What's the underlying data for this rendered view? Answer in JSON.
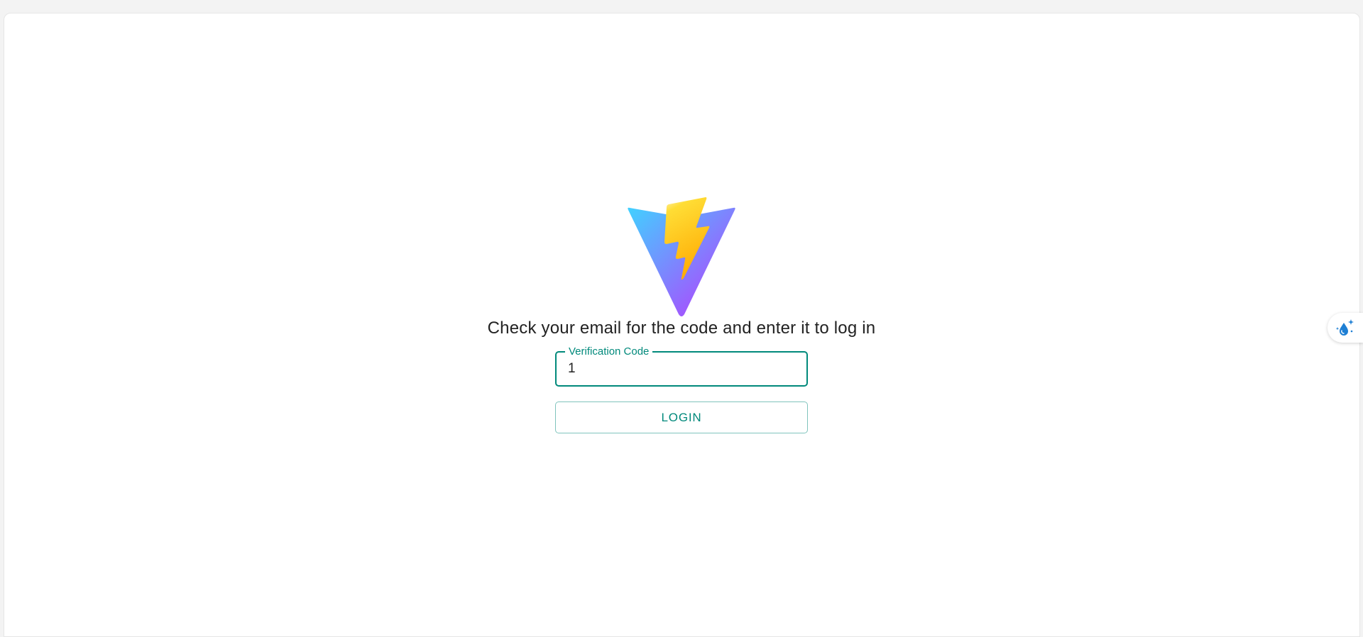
{
  "prompt": "Check your email for the code and enter it to log in",
  "verification_field": {
    "label": "Verification Code",
    "value": "1"
  },
  "login_button": {
    "label": "LOGIN"
  },
  "logo": {
    "icon": "lightning-triangle-logo"
  },
  "side_widget": {
    "icon": "sparkle-drop-icon"
  },
  "colors": {
    "accent": "#00897b",
    "button_border": "#80c4bd",
    "text": "#222222",
    "background": "#ffffff"
  }
}
